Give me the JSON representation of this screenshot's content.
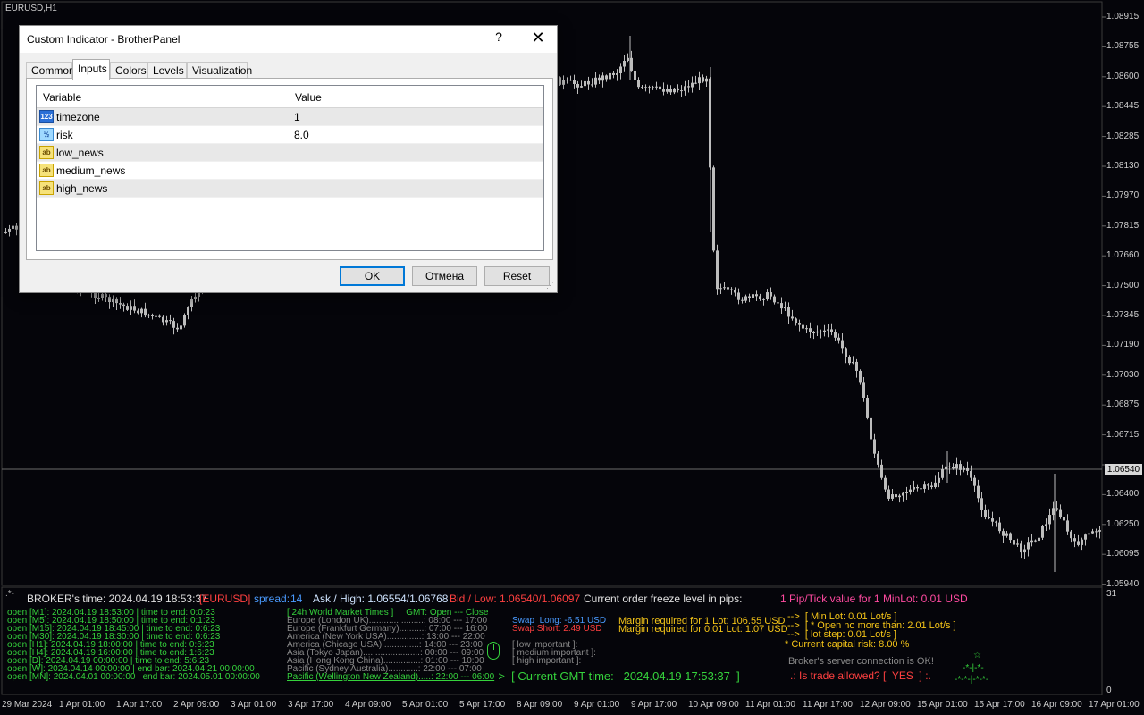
{
  "chart": {
    "symbol": "EURUSD,H1",
    "current_price": "1.06540",
    "price_axis": [
      "1.08915",
      "1.08755",
      "1.08600",
      "1.08445",
      "1.08285",
      "1.08130",
      "1.07970",
      "1.07815",
      "1.07660",
      "1.07500",
      "1.07345",
      "1.07190",
      "1.07030",
      "1.06875",
      "1.06715",
      "1.06400",
      "1.06250",
      "1.06095",
      "1.05940"
    ],
    "time_axis": [
      "29 Mar 2024",
      "1 Apr 01:00",
      "1 Apr 17:00",
      "2 Apr 09:00",
      "3 Apr 01:00",
      "3 Apr 17:00",
      "4 Apr 09:00",
      "5 Apr 01:00",
      "5 Apr 17:00",
      "8 Apr 09:00",
      "9 Apr 01:00",
      "9 Apr 17:00",
      "10 Apr 09:00",
      "11 Apr 01:00",
      "11 Apr 17:00",
      "12 Apr 09:00",
      "15 Apr 01:00",
      "15 Apr 17:00",
      "16 Apr 09:00",
      "17 Apr 01:00"
    ],
    "indicator_axis": [
      "31",
      "0"
    ],
    "colors": {
      "background": "#05050a",
      "candle": "#bdbdbd",
      "grid": "#2a2a2a"
    }
  },
  "dialog": {
    "title": "Custom Indicator - BrotherPanel",
    "help": "?",
    "close": "✕",
    "tabs": [
      "Common",
      "Inputs",
      "Colors",
      "Levels",
      "Visualization"
    ],
    "active_tab": "Inputs",
    "columns": {
      "variable": "Variable",
      "value": "Value"
    },
    "rows": [
      {
        "icon": "123",
        "name": "timezone",
        "value": "1"
      },
      {
        "icon": "½",
        "name": "risk",
        "value": "8.0"
      },
      {
        "icon": "ab",
        "name": "low_news",
        "value": ""
      },
      {
        "icon": "ab",
        "name": "medium_news",
        "value": ""
      },
      {
        "icon": "ab",
        "name": "high_news",
        "value": ""
      }
    ],
    "buttons": {
      "ok": "OK",
      "cancel": "Отмена",
      "reset": "Reset"
    }
  },
  "panel": {
    "header": {
      "broker_time": "BROKER's time: 2024.04.19 18:53:37",
      "symbol": "[EURUSD]",
      "spread_label": "spread:",
      "spread_value": "14",
      "ask": "Ask / High: 1.06554/1.06768",
      "bid": "Bid / Low: 1.06540/1.06097",
      "freeze": "Current order freeze level in pips:",
      "pip_value": "1 Pip/Tick value for 1 MinLot: 0.01 USD"
    },
    "timeframes": [
      "open [M1]: 2024.04.19 18:53:00 | time to end: 0:0:23",
      "open [M5]: 2024.04.19 18:50:00 | time to end: 0:1:23",
      "open [M15]: 2024.04.19 18:45:00 | time to end: 0:6:23",
      "open [M30]: 2024.04.19 18:30:00 | time to end: 0:6:23",
      "open [H1]: 2024.04.19 18:00:00 | time to end: 0:6:23",
      "open [H4]: 2024.04.19 16:00:00 | time to end: 1:6:23",
      "open [D]: 2024.04.19 00:00:00 | time to end: 5:6:23",
      "open [W]: 2024.04.14 00:00:00 | end bar: 2024.04.21 00:00:00",
      "open [MN]: 2024.04.01 00:00:00 | end bar: 2024.05.01 00:00:00"
    ],
    "markets_title": "[ 24h World Market Times ]     GMT: Open --- Close",
    "markets": [
      "Europe (London UK)......................: 08:00 --- 17:00",
      "Europe (Frankfurt Germany)..........: 07:00 --- 16:00",
      "America (New York USA)..............: 13:00 --- 22:00",
      "America (Chicago USA)...............: 14:00 --- 23:00",
      "Asia (Tokyo Japan).......................: 00:00 --- 09:00",
      "Asia (Hong Kong China)...............: 01:00 --- 10:00",
      "Pacific (Sydney Australia)............: 22:00 --- 07:00",
      "Pacific (Wellington New Zealand).....: 22:00 --- 06:00"
    ],
    "swap_long": "Swap  Long: -6.51 USD",
    "swap_short": "Swap Short: 2.49 USD",
    "news": [
      "[ low important ]:",
      "[ medium important ]:",
      "[ high important ]:"
    ],
    "gmt_time": "->  [ Current GMT time:   2024.04.19 17:53:37  ]",
    "margin_1lot": "Margin required for 1 Lot: 106.55 USD",
    "margin_min": "Margin required for 0.01 Lot: 1.07 USD",
    "lot_info": [
      "-->  [ Min Lot: 0.01 Lot/s ]",
      "-->  [ * Open no more than: 2.01 Lot/s ]",
      "-->  [ lot step: 0.01 Lot/s ]"
    ],
    "capital_risk": "* Current capital risk: 8.00 %",
    "server_status": "Broker's server connection is OK!",
    "trade_allowed": ".: Is trade allowed? [  YES  ] :.",
    "tree": [
      "☆",
      "-*-|-*-",
      "-*-*-|-*-*-"
    ],
    "colors": {
      "green": "#35d23c",
      "red": "#ff4040",
      "blue": "#4a9bff",
      "yellow": "#f5c518",
      "magenta": "#ff4aa0",
      "gray": "#8a8a8a"
    }
  }
}
